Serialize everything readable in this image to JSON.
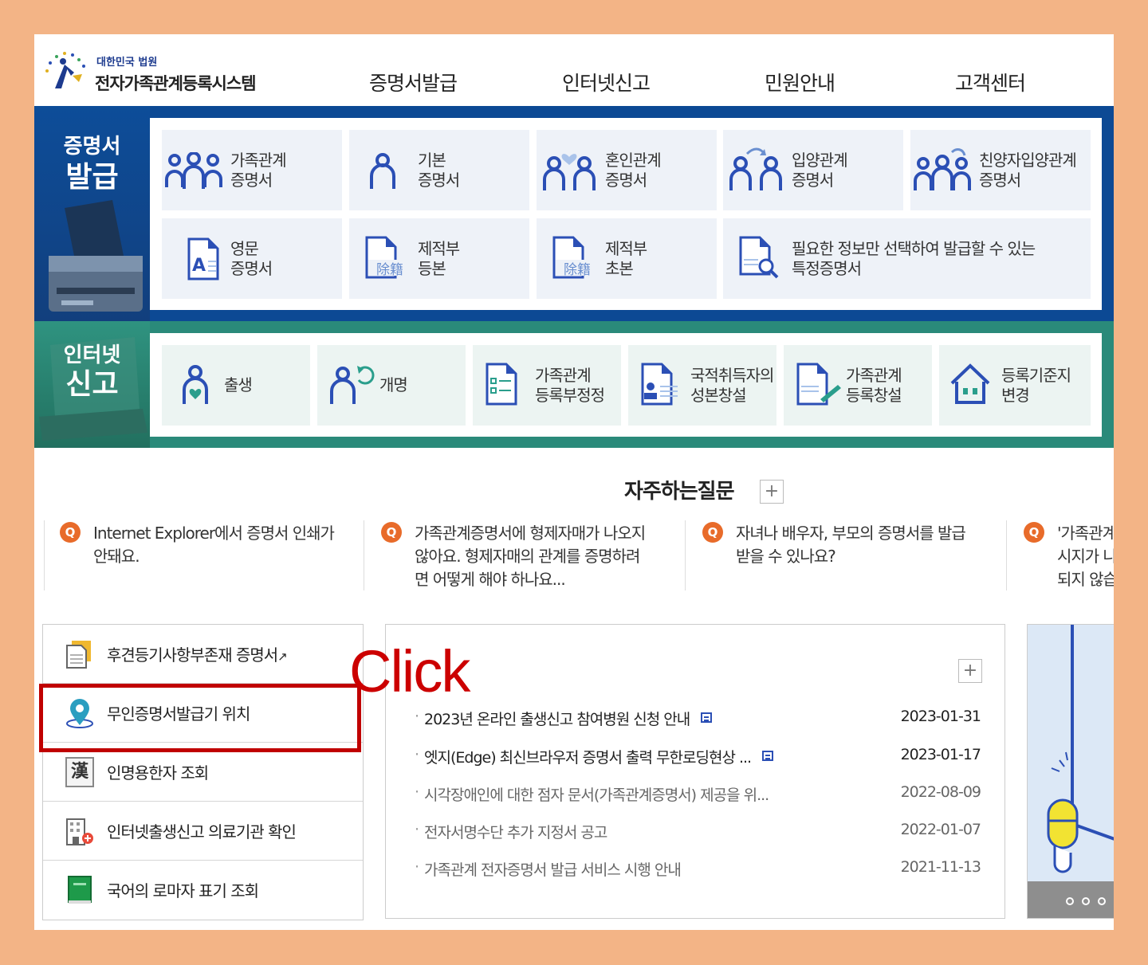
{
  "header": {
    "logo_sub": "대한민국 법원",
    "logo_main": "전자가족관계등록시스템",
    "nav": [
      "증명서발급",
      "인터넷신고",
      "민원안내",
      "고객센터"
    ]
  },
  "cert_panel": {
    "label_top": "증명서",
    "label_bottom": "발급",
    "tiles": [
      {
        "line1": "가족관계",
        "line2": "증명서",
        "icon": "family-group-icon"
      },
      {
        "line1": "기본",
        "line2": "증명서",
        "icon": "person-icon"
      },
      {
        "line1": "혼인관계",
        "line2": "증명서",
        "icon": "couple-heart-icon"
      },
      {
        "line1": "입양관계",
        "line2": "증명서",
        "icon": "adoption-icon"
      },
      {
        "line1": "친양자입양관계",
        "line2": "증명서",
        "icon": "family-adoption-icon"
      },
      {
        "line1": "영문",
        "line2": "증명서",
        "icon": "english-document-icon"
      },
      {
        "line1": "제적부",
        "line2": "등본",
        "icon": "removed-register-icon",
        "stamp": "除籍"
      },
      {
        "line1": "제적부",
        "line2": "초본",
        "icon": "removed-register-icon",
        "stamp": "除籍"
      },
      {
        "line1": "필요한 정보만 선택하여 발급할 수 있는",
        "line2": "특정증명서",
        "icon": "document-search-icon"
      }
    ]
  },
  "report_panel": {
    "label_top": "인터넷",
    "label_bottom": "신고",
    "tiles": [
      {
        "line1": "출생",
        "line2": "",
        "icon": "birth-icon"
      },
      {
        "line1": "개명",
        "line2": "",
        "icon": "rename-icon"
      },
      {
        "line1": "가족관계",
        "line2": "등록부정정",
        "icon": "checklist-icon"
      },
      {
        "line1": "국적취득자의",
        "line2": "성본창설",
        "icon": "id-card-icon"
      },
      {
        "line1": "가족관계",
        "line2": "등록창설",
        "icon": "document-pen-icon"
      },
      {
        "line1": "등록기준지",
        "line2": "변경",
        "icon": "house-icon"
      }
    ]
  },
  "faq": {
    "title": "자주하는질문",
    "more": "+",
    "q_badge": "Q",
    "items": [
      {
        "line1": "Internet Explorer에서 증명서 인쇄가",
        "line2": "안돼요.",
        "line3": ""
      },
      {
        "line1": "가족관계증명서에 형제자매가 나오지",
        "line2": "않아요. 형제자매의 관계를 증명하려",
        "line3": "면 어떻게 해야 하나요..."
      },
      {
        "line1": "자녀나 배우자, 부모의 증명서를 발급",
        "line2": "받을 수 있나요?",
        "line3": ""
      },
      {
        "line1": "'가족관계",
        "line2": "시지가 나",
        "line3": "되지 않습"
      }
    ]
  },
  "quick_links": [
    {
      "label": "후견등기사항부존재 증명서",
      "icon": "document-folder-icon",
      "external": "↗"
    },
    {
      "label": "무인증명서발급기 위치",
      "icon": "location-pin-icon",
      "external": ""
    },
    {
      "label": "인명용한자 조회",
      "icon": "hanja-book-icon",
      "external": "",
      "glyph": "漢"
    },
    {
      "label": "인터넷출생신고 의료기관 확인",
      "icon": "hospital-icon",
      "external": ""
    },
    {
      "label": "국어의 로마자 표기 조회",
      "icon": "green-book-icon",
      "external": ""
    }
  ],
  "notices": {
    "more": "+",
    "items": [
      {
        "title": "2023년 온라인 출생신고 참여병원 신청 안내",
        "date": "2023-01-31",
        "new": true
      },
      {
        "title": "엣지(Edge) 최신브라우저 증명서 출력 무한로딩현상 ...",
        "date": "2023-01-17",
        "new": true
      },
      {
        "title": "시각장애인에 대한 점자 문서(가족관계증명서) 제공을 위...",
        "date": "2022-08-09",
        "new": false
      },
      {
        "title": "전자서명수단 추가 지정서 공고",
        "date": "2022-01-07",
        "new": false
      },
      {
        "title": "가족관계 전자증명서 발급 서비스 시행 안내",
        "date": "2021-11-13",
        "new": false
      }
    ]
  },
  "annotation": {
    "label": "Click",
    "color": "#c00000"
  },
  "colors": {
    "cert_blue": "#0c4994",
    "report_green": "#2a8a7a",
    "icon_blue": "#2b4fb5",
    "faq_orange": "#e86b2a",
    "frame": "#f3b486"
  }
}
